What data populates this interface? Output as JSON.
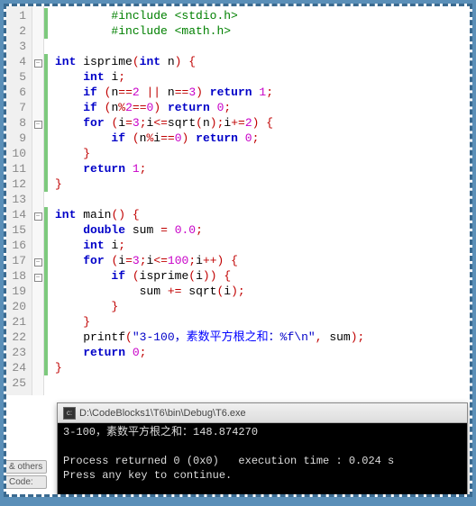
{
  "lines": [
    {
      "n": 1,
      "marker": true,
      "fold": "",
      "tokens": [
        [
          "sp",
          "        "
        ],
        [
          "pp",
          "#include <stdio.h>"
        ]
      ]
    },
    {
      "n": 2,
      "marker": true,
      "fold": "",
      "tokens": [
        [
          "sp",
          "        "
        ],
        [
          "pp",
          "#include <math.h>"
        ]
      ]
    },
    {
      "n": 3,
      "marker": false,
      "fold": "",
      "tokens": []
    },
    {
      "n": 4,
      "marker": true,
      "fold": "-",
      "tokens": [
        [
          "kw",
          "int"
        ],
        [
          "sp",
          " "
        ],
        [
          "fn",
          "isprime"
        ],
        [
          "op",
          "("
        ],
        [
          "kw",
          "int"
        ],
        [
          "sp",
          " "
        ],
        [
          "pl",
          "n"
        ],
        [
          "op",
          ")"
        ],
        [
          "sp",
          " "
        ],
        [
          "br",
          "{"
        ]
      ]
    },
    {
      "n": 5,
      "marker": true,
      "fold": "",
      "tokens": [
        [
          "sp",
          "    "
        ],
        [
          "kw",
          "int"
        ],
        [
          "sp",
          " "
        ],
        [
          "pl",
          "i"
        ],
        [
          "op",
          ";"
        ]
      ]
    },
    {
      "n": 6,
      "marker": true,
      "fold": "",
      "tokens": [
        [
          "sp",
          "    "
        ],
        [
          "kw",
          "if"
        ],
        [
          "sp",
          " "
        ],
        [
          "op",
          "("
        ],
        [
          "pl",
          "n"
        ],
        [
          "op",
          "=="
        ],
        [
          "num",
          "2"
        ],
        [
          "sp",
          " "
        ],
        [
          "op",
          "||"
        ],
        [
          "sp",
          " "
        ],
        [
          "pl",
          "n"
        ],
        [
          "op",
          "=="
        ],
        [
          "num",
          "3"
        ],
        [
          "op",
          ")"
        ],
        [
          "sp",
          " "
        ],
        [
          "kw",
          "return"
        ],
        [
          "sp",
          " "
        ],
        [
          "num",
          "1"
        ],
        [
          "op",
          ";"
        ]
      ]
    },
    {
      "n": 7,
      "marker": true,
      "fold": "",
      "tokens": [
        [
          "sp",
          "    "
        ],
        [
          "kw",
          "if"
        ],
        [
          "sp",
          " "
        ],
        [
          "op",
          "("
        ],
        [
          "pl",
          "n"
        ],
        [
          "op",
          "%"
        ],
        [
          "num",
          "2"
        ],
        [
          "op",
          "=="
        ],
        [
          "num",
          "0"
        ],
        [
          "op",
          ")"
        ],
        [
          "sp",
          " "
        ],
        [
          "kw",
          "return"
        ],
        [
          "sp",
          " "
        ],
        [
          "num",
          "0"
        ],
        [
          "op",
          ";"
        ]
      ]
    },
    {
      "n": 8,
      "marker": true,
      "fold": "-",
      "tokens": [
        [
          "sp",
          "    "
        ],
        [
          "kw",
          "for"
        ],
        [
          "sp",
          " "
        ],
        [
          "op",
          "("
        ],
        [
          "pl",
          "i"
        ],
        [
          "op",
          "="
        ],
        [
          "num",
          "3"
        ],
        [
          "op",
          ";"
        ],
        [
          "pl",
          "i"
        ],
        [
          "op",
          "<="
        ],
        [
          "fn",
          "sqrt"
        ],
        [
          "op",
          "("
        ],
        [
          "pl",
          "n"
        ],
        [
          "op",
          ")"
        ],
        [
          "op",
          ";"
        ],
        [
          "pl",
          "i"
        ],
        [
          "op",
          "+="
        ],
        [
          "num",
          "2"
        ],
        [
          "op",
          ")"
        ],
        [
          "sp",
          " "
        ],
        [
          "br",
          "{"
        ]
      ]
    },
    {
      "n": 9,
      "marker": true,
      "fold": "",
      "tokens": [
        [
          "sp",
          "        "
        ],
        [
          "kw",
          "if"
        ],
        [
          "sp",
          " "
        ],
        [
          "op",
          "("
        ],
        [
          "pl",
          "n"
        ],
        [
          "op",
          "%"
        ],
        [
          "pl",
          "i"
        ],
        [
          "op",
          "=="
        ],
        [
          "num",
          "0"
        ],
        [
          "op",
          ")"
        ],
        [
          "sp",
          " "
        ],
        [
          "kw",
          "return"
        ],
        [
          "sp",
          " "
        ],
        [
          "num",
          "0"
        ],
        [
          "op",
          ";"
        ]
      ]
    },
    {
      "n": 10,
      "marker": true,
      "fold": "",
      "tokens": [
        [
          "sp",
          "    "
        ],
        [
          "br",
          "}"
        ]
      ]
    },
    {
      "n": 11,
      "marker": true,
      "fold": "",
      "tokens": [
        [
          "sp",
          "    "
        ],
        [
          "kw",
          "return"
        ],
        [
          "sp",
          " "
        ],
        [
          "num",
          "1"
        ],
        [
          "op",
          ";"
        ]
      ]
    },
    {
      "n": 12,
      "marker": true,
      "fold": "",
      "tokens": [
        [
          "br",
          "}"
        ]
      ]
    },
    {
      "n": 13,
      "marker": false,
      "fold": "",
      "tokens": []
    },
    {
      "n": 14,
      "marker": true,
      "fold": "-",
      "tokens": [
        [
          "kw",
          "int"
        ],
        [
          "sp",
          " "
        ],
        [
          "fn",
          "main"
        ],
        [
          "op",
          "()"
        ],
        [
          "sp",
          " "
        ],
        [
          "br",
          "{"
        ]
      ]
    },
    {
      "n": 15,
      "marker": true,
      "fold": "",
      "tokens": [
        [
          "sp",
          "    "
        ],
        [
          "kw",
          "double"
        ],
        [
          "sp",
          " "
        ],
        [
          "pl",
          "sum"
        ],
        [
          "sp",
          " "
        ],
        [
          "op",
          "="
        ],
        [
          "sp",
          " "
        ],
        [
          "num",
          "0.0"
        ],
        [
          "op",
          ";"
        ]
      ]
    },
    {
      "n": 16,
      "marker": true,
      "fold": "",
      "tokens": [
        [
          "sp",
          "    "
        ],
        [
          "kw",
          "int"
        ],
        [
          "sp",
          " "
        ],
        [
          "pl",
          "i"
        ],
        [
          "op",
          ";"
        ]
      ]
    },
    {
      "n": 17,
      "marker": true,
      "fold": "-",
      "tokens": [
        [
          "sp",
          "    "
        ],
        [
          "kw",
          "for"
        ],
        [
          "sp",
          " "
        ],
        [
          "op",
          "("
        ],
        [
          "pl",
          "i"
        ],
        [
          "op",
          "="
        ],
        [
          "num",
          "3"
        ],
        [
          "op",
          ";"
        ],
        [
          "pl",
          "i"
        ],
        [
          "op",
          "<="
        ],
        [
          "num",
          "100"
        ],
        [
          "op",
          ";"
        ],
        [
          "pl",
          "i"
        ],
        [
          "op",
          "++)"
        ],
        [
          "sp",
          " "
        ],
        [
          "br",
          "{"
        ]
      ]
    },
    {
      "n": 18,
      "marker": true,
      "fold": "-",
      "tokens": [
        [
          "sp",
          "        "
        ],
        [
          "kw",
          "if"
        ],
        [
          "sp",
          " "
        ],
        [
          "op",
          "("
        ],
        [
          "fn",
          "isprime"
        ],
        [
          "op",
          "("
        ],
        [
          "pl",
          "i"
        ],
        [
          "op",
          "))"
        ],
        [
          "sp",
          " "
        ],
        [
          "br",
          "{"
        ]
      ]
    },
    {
      "n": 19,
      "marker": true,
      "fold": "",
      "tokens": [
        [
          "sp",
          "            "
        ],
        [
          "pl",
          "sum"
        ],
        [
          "sp",
          " "
        ],
        [
          "op",
          "+="
        ],
        [
          "sp",
          " "
        ],
        [
          "fn",
          "sqrt"
        ],
        [
          "op",
          "("
        ],
        [
          "pl",
          "i"
        ],
        [
          "op",
          ")"
        ],
        [
          "op",
          ";"
        ]
      ]
    },
    {
      "n": 20,
      "marker": true,
      "fold": "",
      "tokens": [
        [
          "sp",
          "        "
        ],
        [
          "br",
          "}"
        ]
      ]
    },
    {
      "n": 21,
      "marker": true,
      "fold": "",
      "tokens": [
        [
          "sp",
          "    "
        ],
        [
          "br",
          "}"
        ]
      ]
    },
    {
      "n": 22,
      "marker": true,
      "fold": "",
      "tokens": [
        [
          "sp",
          "    "
        ],
        [
          "fn",
          "printf"
        ],
        [
          "op",
          "("
        ],
        [
          "str",
          "\"3-100，"
        ],
        [
          "strcn",
          "素数平方根之和"
        ],
        [
          "str",
          "：%f\\n\""
        ],
        [
          "op",
          ","
        ],
        [
          "sp",
          " "
        ],
        [
          "pl",
          "sum"
        ],
        [
          "op",
          ")"
        ],
        [
          "op",
          ";"
        ]
      ]
    },
    {
      "n": 23,
      "marker": true,
      "fold": "",
      "tokens": [
        [
          "sp",
          "    "
        ],
        [
          "kw",
          "return"
        ],
        [
          "sp",
          " "
        ],
        [
          "num",
          "0"
        ],
        [
          "op",
          ";"
        ]
      ]
    },
    {
      "n": 24,
      "marker": true,
      "fold": "",
      "tokens": [
        [
          "br",
          "}"
        ]
      ]
    },
    {
      "n": 25,
      "marker": false,
      "fold": "",
      "tokens": []
    }
  ],
  "console": {
    "title": "D:\\CodeBlocks1\\T6\\bin\\Debug\\T6.exe",
    "line1": "3-100，素数平方根之和：148.874270",
    "line2": "",
    "line3": "Process returned 0 (0x0)   execution time : 0.024 s",
    "line4": "Press any key to continue."
  },
  "left_tabs": {
    "tab1": "& others",
    "tab2": "Code:"
  }
}
